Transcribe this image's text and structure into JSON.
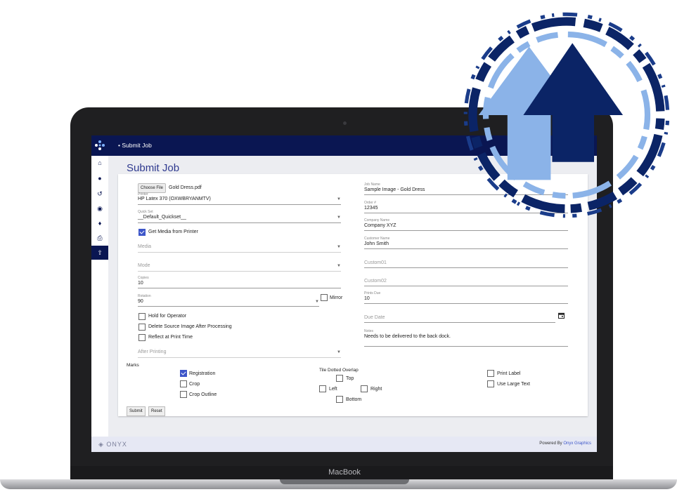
{
  "device": {
    "brand_label": "MacBook"
  },
  "topbar": {
    "breadcrumb": "•  Submit Job"
  },
  "sidebar": {
    "icons": [
      "home-icon",
      "globe-icon",
      "history-icon",
      "palette-icon",
      "network-icon",
      "printer-icon",
      "upload-icon"
    ]
  },
  "page": {
    "title": "Submit Job"
  },
  "form": {
    "choose_file_label": "Choose File",
    "file_name": "Gold Dress.pdf",
    "printer": {
      "label": "Printer",
      "value": "HP Latex 370 (OXWBRYANMTV)"
    },
    "quick_set": {
      "label": "Quick Set",
      "value": "__Default_Quickset__"
    },
    "get_media": {
      "label": "Get Media from Printer",
      "checked": true
    },
    "media": {
      "placeholder": "Media"
    },
    "mode": {
      "placeholder": "Mode"
    },
    "copies": {
      "label": "Copies",
      "value": "10"
    },
    "rotation": {
      "label": "Rotation",
      "value": "90"
    },
    "mirror": {
      "label": "Mirror",
      "checked": false
    },
    "hold_for_operator": {
      "label": "Hold for Operator",
      "checked": false
    },
    "delete_source": {
      "label": "Delete Source Image After Processing",
      "checked": false
    },
    "reflect": {
      "label": "Reflect at Print Time",
      "checked": false
    },
    "after_printing": {
      "placeholder": "After Printing"
    },
    "job_name": {
      "label": "Job Name",
      "value": "Sample Image - Gold Dress"
    },
    "order": {
      "label": "Order #",
      "value": "12345"
    },
    "company": {
      "label": "Company Name",
      "value": "Company XYZ"
    },
    "customer": {
      "label": "Customer Name",
      "value": "John Smith"
    },
    "custom01": {
      "placeholder": "Custom01"
    },
    "custom02": {
      "placeholder": "Custom02"
    },
    "prints_due": {
      "label": "Prints Due",
      "value": "10"
    },
    "due_date": {
      "placeholder": "Due Date"
    },
    "notes": {
      "label": "Notes",
      "value": "Needs to be delivered to the back dock."
    }
  },
  "marks": {
    "label": "Marks",
    "registration": {
      "label": "Registration",
      "checked": true
    },
    "crop": {
      "label": "Crop",
      "checked": false
    },
    "crop_outline": {
      "label": "Crop Outline",
      "checked": false
    },
    "tile_label": "Tile Dotted Overlap",
    "top": {
      "label": "Top",
      "checked": false
    },
    "left": {
      "label": "Left",
      "checked": false
    },
    "right": {
      "label": "Right",
      "checked": false
    },
    "bottom": {
      "label": "Bottom",
      "checked": false
    },
    "print_label": {
      "label": "Print Label",
      "checked": false
    },
    "use_large_text": {
      "label": "Use Large Text",
      "checked": false
    }
  },
  "buttons": {
    "submit": "Submit",
    "reset": "Reset"
  },
  "footer": {
    "brand": "ONYX",
    "powered_prefix": "Powered By ",
    "powered_link": "Onyx Graphics"
  },
  "colors": {
    "navy": "#0a1652",
    "accent": "#3d56c9",
    "arrow_light": "#8bb3e8",
    "arrow_dark": "#0b2466"
  }
}
